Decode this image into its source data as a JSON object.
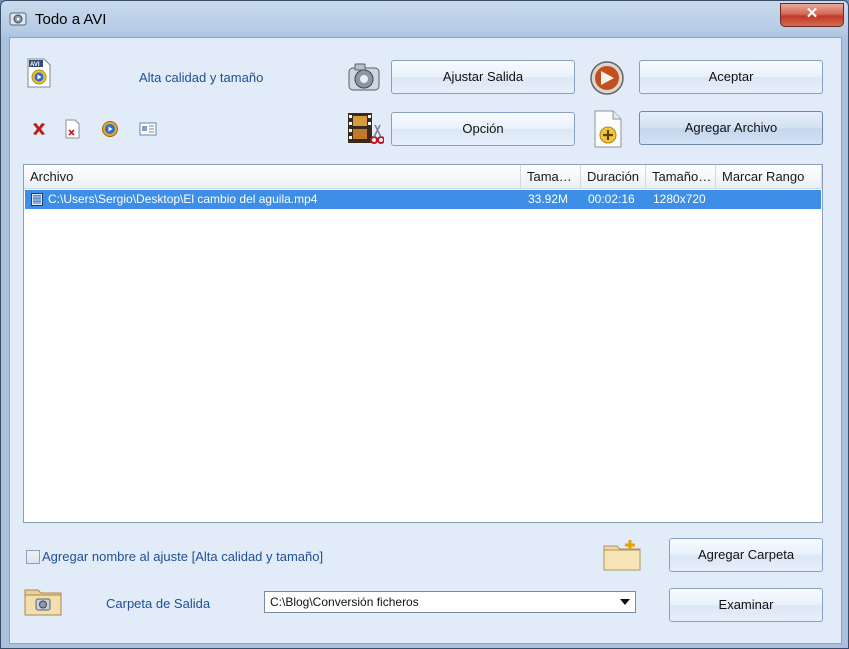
{
  "window": {
    "title": "Todo a AVI",
    "close_glyph": "✕"
  },
  "profile": {
    "name": "Alta calidad y tamaño"
  },
  "buttons": {
    "ajustar_salida": "Ajustar Salida",
    "aceptar": "Aceptar",
    "opcion": "Opción",
    "agregar_archivo": "Agregar Archivo",
    "agregar_carpeta": "Agregar Carpeta",
    "examinar": "Examinar"
  },
  "toolbar_icons": [
    "delete-icon",
    "remove-file-icon",
    "play-icon",
    "info-icon"
  ],
  "file_list": {
    "columns": [
      "Archivo",
      "Tama…",
      "Duración",
      "Tamaño…",
      "Marcar Rango"
    ],
    "rows": [
      {
        "archivo": "C:\\Users\\Sergio\\Desktop\\El cambio del  aguila.mp4",
        "tamano": "33.92M",
        "duracion": "00:02:16",
        "resolucion": "1280x720",
        "rango": ""
      }
    ]
  },
  "options": {
    "add_name_label": "Agregar nombre al ajuste [Alta calidad y tamaño]",
    "add_name_checked": false
  },
  "output": {
    "label": "Carpeta de Salida",
    "folder": "C:\\Blog\\Conversión ficheros"
  },
  "colors": {
    "selection": "#3d8ee6",
    "label_blue": "#1f4f96",
    "close_red": "#c0392b"
  }
}
